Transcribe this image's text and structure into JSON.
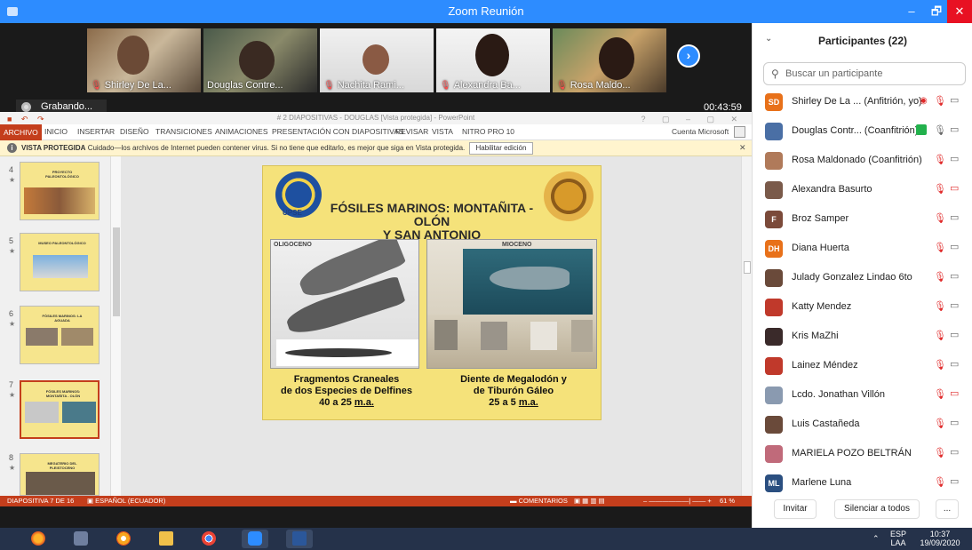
{
  "window": {
    "title": "Zoom Reunión",
    "minimize": "–",
    "maximize": "🗗",
    "close": "✕"
  },
  "gallery": {
    "tiles": [
      {
        "name": "Shirley De La..."
      },
      {
        "name": "Douglas Contre..."
      },
      {
        "name": "Nachita Rami..."
      },
      {
        "name": "Alexandra Ba..."
      },
      {
        "name": "Rosa Maldo..."
      }
    ],
    "next_glyph": "›",
    "recording_label": "Grabando...",
    "timer": "00:43:59"
  },
  "ppt": {
    "window_title": "# 2 DIAPOSITIVAS - DOUGLAS [Vista protegida] - PowerPoint",
    "tabs": [
      "ARCHIVO",
      "INICIO",
      "INSERTAR",
      "DISEÑO",
      "TRANSICIONES",
      "ANIMACIONES",
      "PRESENTACIÓN CON DIAPOSITIVAS",
      "REVISAR",
      "VISTA",
      "NITRO PRO 10"
    ],
    "account": "Cuenta Microsoft",
    "protected_bar": {
      "label": "VISTA PROTEGIDA",
      "message": "Cuidado—los archivos de Internet pueden contener virus. Si no tiene que editarlo, es mejor que siga en Vista protegida.",
      "button": "Habilitar edición"
    },
    "thumbnails": [
      {
        "num": "4",
        "title": "PROYECTO PALEONTOLÓGICO"
      },
      {
        "num": "5",
        "title": "MUSEO PALEONTOLÓGICO"
      },
      {
        "num": "6",
        "title": "FÓSILES MARINOS: LA AGUADA"
      },
      {
        "num": "7",
        "title": "FÓSILES MARINOS: MONTAÑITA - OLÓN"
      },
      {
        "num": "8",
        "title": "MEGATERIO DEL PLEISTOCENO"
      }
    ],
    "slide": {
      "logo_left_label": "UPSE",
      "title_line1": "FÓSILES MARINOS: MONTAÑITA - OLÓN",
      "title_line2": "Y SAN ANTONIO",
      "era_left": "OLIGOCENO",
      "era_right": "MIOCENO",
      "caption_left_1": "Fragmentos  Craneales",
      "caption_left_2": "de dos Especies de Delfines",
      "caption_left_3a": "40 a 25 ",
      "caption_left_3b": "m.a.",
      "caption_right_1": "Diente de Megalodón y",
      "caption_right_2": "de Tiburón Gáleo",
      "caption_right_3a": "25 a 5 ",
      "caption_right_3b": "m.a."
    },
    "status": {
      "slide_of": "DIAPOSITIVA 7 DE 16",
      "language": "ESPAÑOL (ECUADOR)",
      "comments": "COMENTARIOS",
      "zoom": "61 %"
    }
  },
  "participants": {
    "title": "Participantes (22)",
    "search_placeholder": "Buscar un participante",
    "list": [
      {
        "initials": "SD",
        "color": "#e8711a",
        "name": "Shirley De La ... (Anfitrión, yo)",
        "cam_off": false
      },
      {
        "initials": "",
        "color": "#4a6fa5",
        "name": "Douglas Contr... (Coanfitrión)",
        "cam_off": false
      },
      {
        "initials": "",
        "color": "#b07a5a",
        "name": "Rosa Maldonado (Coanfitrión)",
        "cam_off": false
      },
      {
        "initials": "",
        "color": "#7a5a4a",
        "name": "Alexandra Basurto",
        "cam_off": true
      },
      {
        "initials": "F",
        "color": "#7b4a3a",
        "name": "Broz Samper",
        "cam_off": false
      },
      {
        "initials": "DH",
        "color": "#e8711a",
        "name": "Diana Huerta",
        "cam_off": false
      },
      {
        "initials": "",
        "color": "#6a4a3a",
        "name": "Julady Gonzalez Lindao 6to",
        "cam_off": false
      },
      {
        "initials": "",
        "color": "#c0392b",
        "name": "Katty Mendez",
        "cam_off": false
      },
      {
        "initials": "",
        "color": "#3a2a2a",
        "name": "Kris MaZhi",
        "cam_off": false
      },
      {
        "initials": "",
        "color": "#c0392b",
        "name": "Lainez Méndez",
        "cam_off": false
      },
      {
        "initials": "",
        "color": "#8a9ab0",
        "name": "Lcdo. Jonathan Villón",
        "cam_off": true
      },
      {
        "initials": "",
        "color": "#6a4a3a",
        "name": "Luis Castañeda",
        "cam_off": false
      },
      {
        "initials": "",
        "color": "#c06a7a",
        "name": "MARIELA POZO BELTRÁN",
        "cam_off": false
      },
      {
        "initials": "ML",
        "color": "#2b4f80",
        "name": "Marlene Luna",
        "cam_off": false
      }
    ],
    "invite": "Invitar",
    "mute_all": "Silenciar a todos",
    "more": "..."
  },
  "taskbar": {
    "lang_top": "ESP",
    "lang_bottom": "LAA",
    "time": "10:37",
    "date": "19/09/2020"
  }
}
